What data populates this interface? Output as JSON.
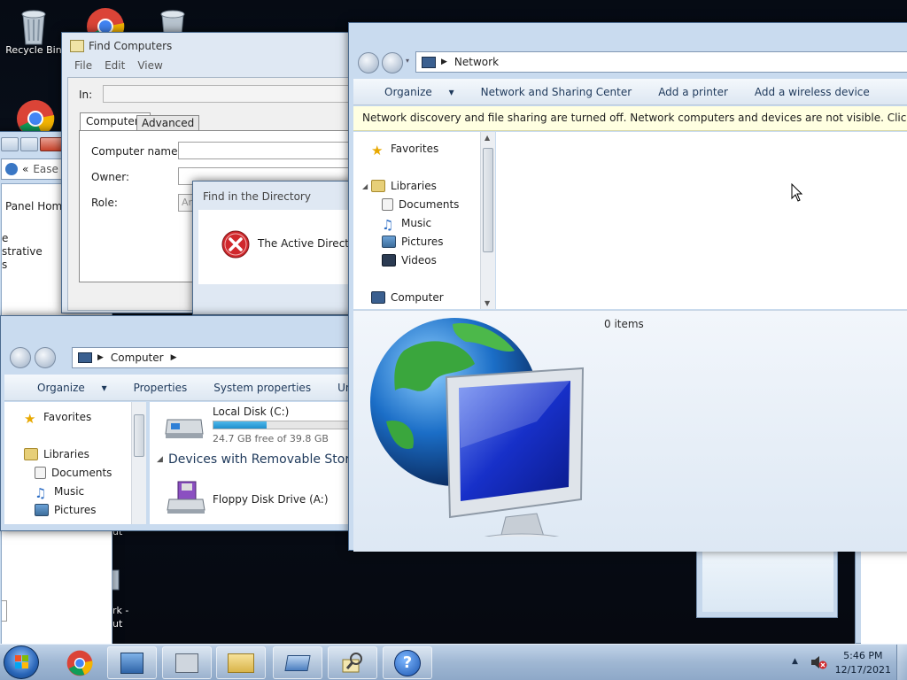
{
  "desktop": {
    "icons": [
      {
        "label": "Recycle Bin"
      },
      {
        "label": ""
      },
      {
        "label": ""
      },
      {
        "label": ""
      }
    ],
    "partial_labels": {
      "ut1": "ut",
      "work": "rk -",
      "ut2": "ut"
    }
  },
  "find_computers": {
    "title": "Find Computers",
    "menu": [
      "File",
      "Edit",
      "View"
    ],
    "in_label": "In:",
    "tabs": [
      "Computers",
      "Advanced"
    ],
    "fields": [
      {
        "label": "Computer name:",
        "value": ""
      },
      {
        "label": "Owner:",
        "value": ""
      },
      {
        "label": "Role:",
        "value": "An"
      }
    ]
  },
  "find_directory": {
    "title": "Find in the Directory",
    "message": "The Active Director"
  },
  "control_panel": {
    "breadcrumb_prefix": "«",
    "breadcrumb": "Ease",
    "items": [
      "Panel Home",
      "e",
      "strative",
      "s"
    ]
  },
  "computer_window": {
    "address": "Computer",
    "toolbar": [
      "Organize",
      "Properties",
      "System properties",
      "Uninstall or c"
    ],
    "nav": {
      "favorites": "Favorites",
      "libraries": "Libraries",
      "items": [
        "Documents",
        "Music",
        "Pictures"
      ]
    },
    "drive": {
      "name": "Local Disk (C:)",
      "free_text": "24.7 GB free of 39.8 GB",
      "used_fraction": 0.38
    },
    "group_header": "Devices with Removable Storag",
    "floppy": "Floppy Disk Drive (A:)"
  },
  "network_window": {
    "address": "Network",
    "toolbar": [
      "Organize",
      "Network and Sharing Center",
      "Add a printer",
      "Add a wireless device"
    ],
    "info_bar": "Network discovery and file sharing are turned off. Network computers and devices are not visible. Click to change...",
    "nav": {
      "favorites": "Favorites",
      "libraries": "Libraries",
      "items": [
        "Documents",
        "Music",
        "Pictures",
        "Videos"
      ],
      "computer": "Computer"
    },
    "status": "0 items"
  },
  "taskbar": {
    "time": "5:46 PM",
    "date": "12/17/2021"
  },
  "colors": {
    "accent": "#1e395b",
    "info_bar": "#ffffe1",
    "drive_bar": "#26a0da"
  }
}
